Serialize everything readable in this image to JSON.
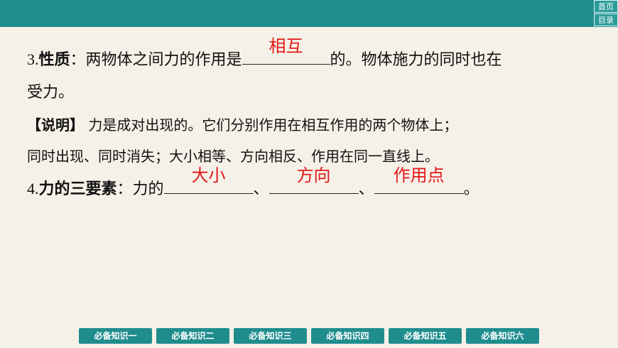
{
  "nav": {
    "home": "首页",
    "toc": "目录"
  },
  "item3": {
    "num": "3.",
    "title": "性质",
    "colon": "：",
    "text_before": "两物体之间力的作用是",
    "answer": "相互",
    "text_after": "的。物体施力的同时也在",
    "text_line2": "受力。"
  },
  "note": {
    "tag": "【说明】",
    "line1": "力是成对出现的。它们分别作用在相互作用的两个物体上；",
    "line2": "同时出现、同时消失；大小相等、方向相反、作用在同一直线上。"
  },
  "item4": {
    "num": "4.",
    "title": "力的三要素",
    "colon": "：",
    "text_before": "力的",
    "answers": [
      "大小",
      "方向",
      "作用点"
    ],
    "sep": "、",
    "end": "。"
  },
  "tabs": [
    "必备知识一",
    "必备知识二",
    "必备知识三",
    "必备知识四",
    "必备知识五",
    "必备知识六"
  ],
  "colors": {
    "header": "#1f8d8e",
    "answer": "#e21818",
    "background": "#f6f1e8"
  }
}
